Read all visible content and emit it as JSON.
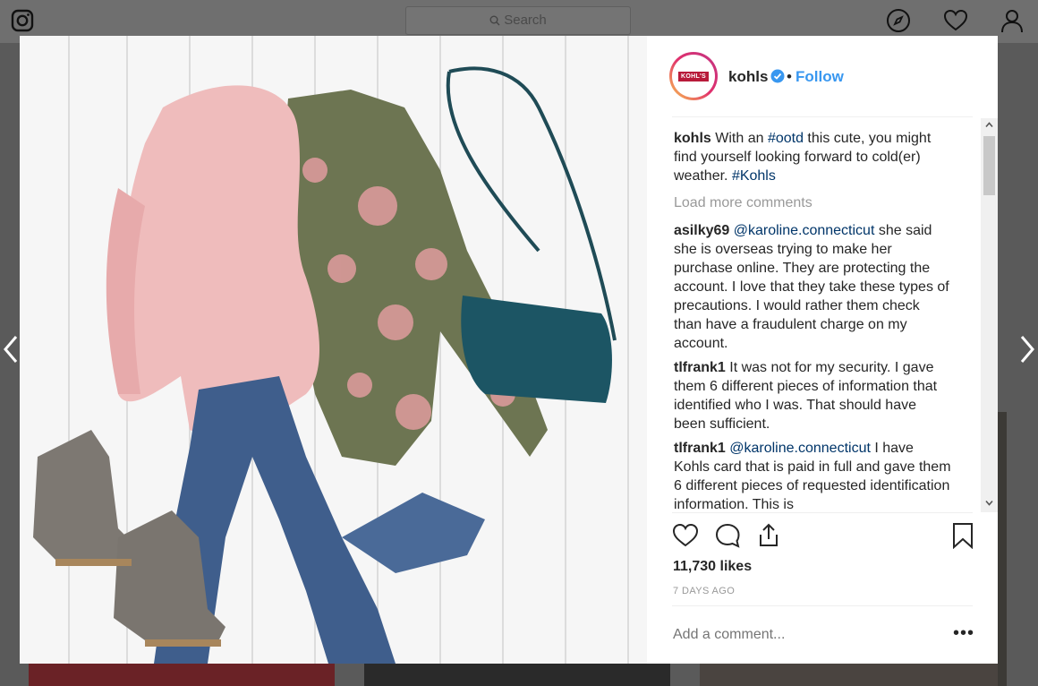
{
  "topbar": {
    "search_placeholder": "Search"
  },
  "post": {
    "username": "kohls",
    "follow_label": "Follow",
    "avatar_text": "KOHL'S",
    "caption": {
      "user": "kohls",
      "text_before": "With an ",
      "hashtag1": "#ootd",
      "text_middle": " this cute, you might find yourself looking forward to cold(er) weather. ",
      "hashtag2": "#Kohls"
    },
    "load_more_label": "Load more comments",
    "comments": [
      {
        "user": "asilky69",
        "mention": "@karoline.connecticut",
        "text": " she said she is overseas trying to make her purchase online. They are protecting the account. I love that they take these types of precautions. I would rather them check than have a fraudulent charge on my account."
      },
      {
        "user": "tlfrank1",
        "mention": "",
        "text": " It was not for my security. I gave them 6 different pieces of information that identified who I was. That should have been sufficient."
      },
      {
        "user": "tlfrank1",
        "mention": "@karoline.connecticut",
        "text": " I have Kohls card that is paid in full and gave them 6 different pieces of requested identification information. This is"
      }
    ],
    "likes": "11,730 likes",
    "timestamp": "7 DAYS AGO",
    "add_comment_placeholder": "Add a comment...",
    "more_options": "•••"
  },
  "colors": {
    "accent": "#3897f0",
    "link": "#003569",
    "muted": "#999999",
    "text": "#262626"
  },
  "icons": [
    "instagram-icon",
    "search-icon",
    "compass-icon",
    "heart-icon",
    "profile-icon",
    "verified-icon",
    "like-icon",
    "comment-icon",
    "share-icon",
    "bookmark-icon",
    "chevron-left-icon",
    "chevron-right-icon"
  ]
}
